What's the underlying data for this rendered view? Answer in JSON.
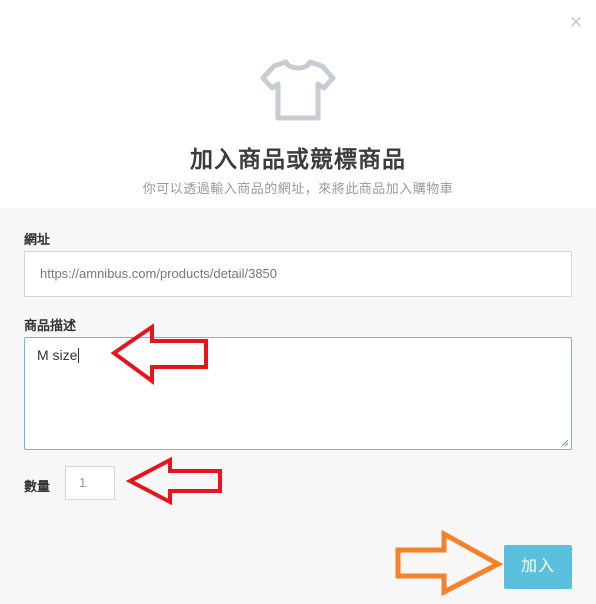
{
  "dialog": {
    "close_label": "×",
    "icon": "tshirt-icon",
    "title": "加入商品或競標商品",
    "subtitle": "你可以透過輸入商品的網址，來將此商品加入購物車"
  },
  "form": {
    "url_label": "網址",
    "url_value": "https://amnibus.com/products/detail/3850",
    "desc_label": "商品描述",
    "desc_value": "M size",
    "qty_label": "數量",
    "qty_value": "1",
    "submit_label": "加入"
  },
  "annotations": {
    "arrow_color_red": "#e8141b",
    "arrow_color_orange": "#f5822a",
    "icons": [
      "red-arrow-left-icon",
      "red-arrow-left-icon",
      "orange-arrow-right-icon"
    ]
  },
  "colors": {
    "button_bg": "#5bc0de",
    "focus_border": "#74b3e0",
    "form_bg": "#f7f7f7"
  }
}
